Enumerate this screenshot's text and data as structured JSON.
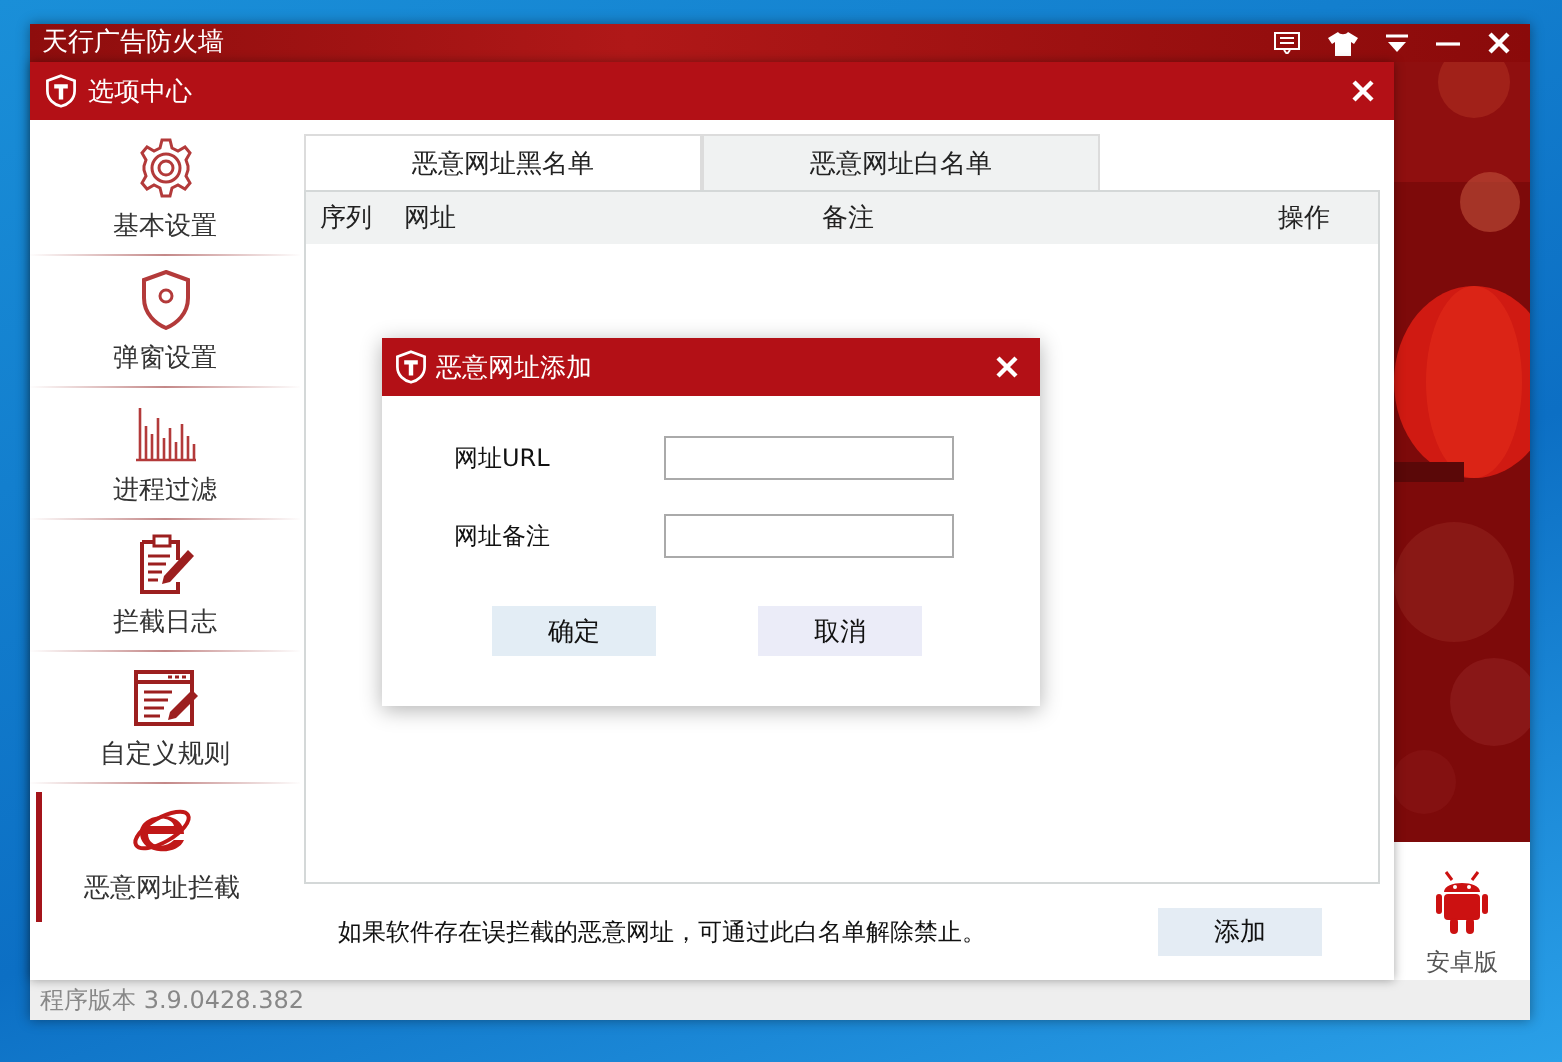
{
  "back_window": {
    "title": "天行广告防火墙",
    "version": "程序版本 3.9.0428.382",
    "android_label": "安卓版"
  },
  "options_window": {
    "title": "选项中心",
    "sidebar": {
      "items": [
        {
          "label": "基本设置",
          "kind": "gear",
          "selected": false
        },
        {
          "label": "弹窗设置",
          "kind": "shield",
          "selected": false
        },
        {
          "label": "进程过滤",
          "kind": "bars",
          "selected": false
        },
        {
          "label": "拦截日志",
          "kind": "clipboard",
          "selected": false
        },
        {
          "label": "自定义规则",
          "kind": "editor",
          "selected": false
        },
        {
          "label": "恶意网址拦截",
          "kind": "browser",
          "selected": true
        }
      ]
    },
    "tabs": [
      {
        "label": "恶意网址黑名单",
        "selected": false
      },
      {
        "label": "恶意网址白名单",
        "selected": true
      }
    ],
    "table": {
      "columns": [
        "序列",
        "网址",
        "备注",
        "操作"
      ]
    },
    "hint": "如果软件存在误拦截的恶意网址，可通过此白名单解除禁止。",
    "add_button": "添加"
  },
  "dialog": {
    "title": "恶意网址添加",
    "fields": [
      {
        "label": "网址URL"
      },
      {
        "label": "网址备注"
      }
    ],
    "buttons": [
      "确定",
      "取消"
    ]
  }
}
